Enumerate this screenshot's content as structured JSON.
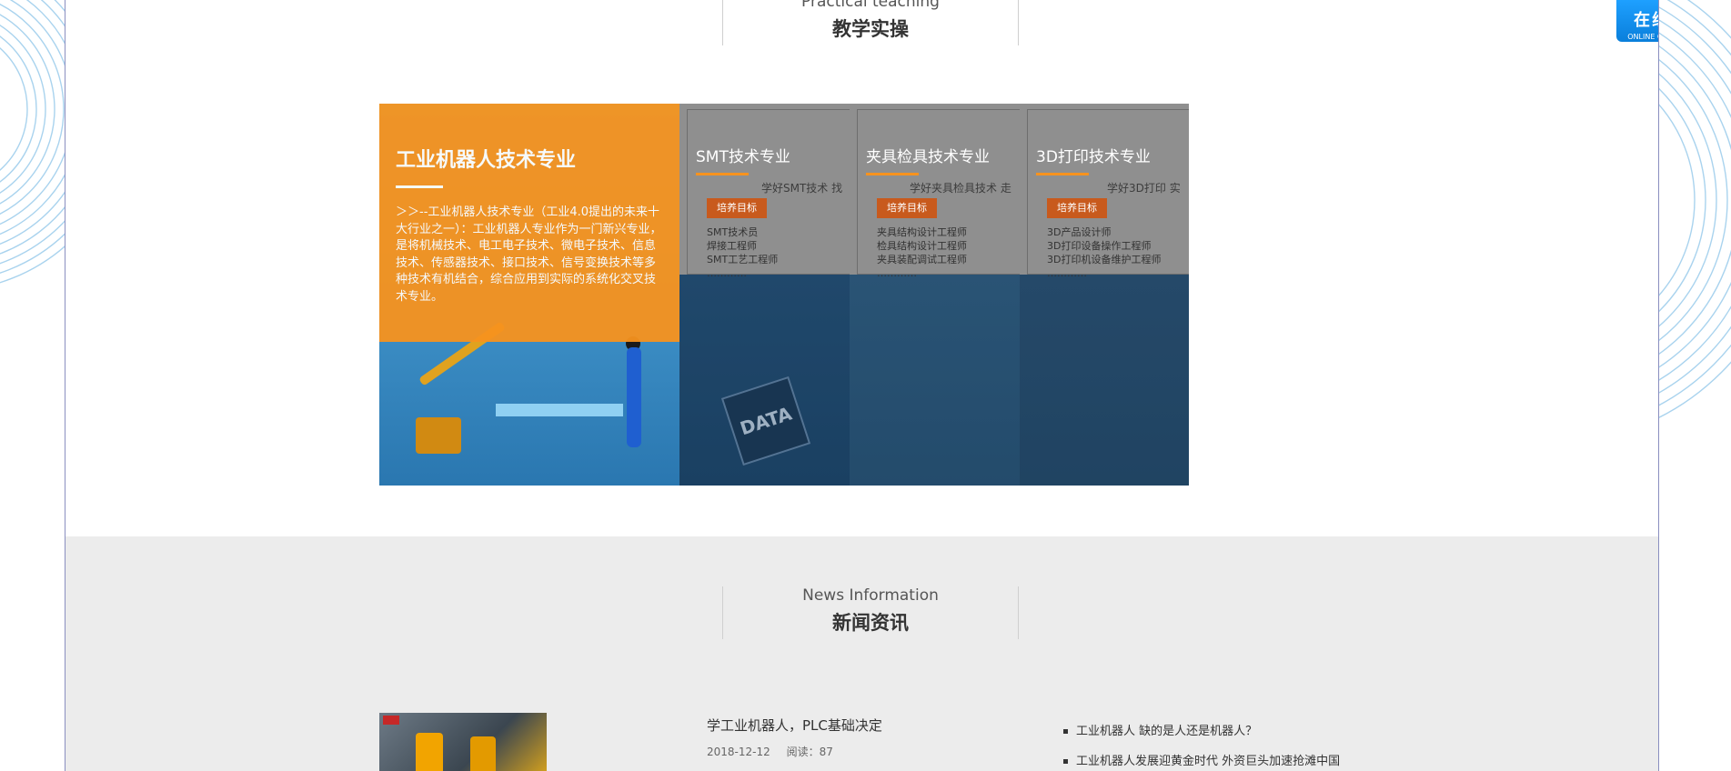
{
  "practical_section": {
    "en_title": "Practical teaching",
    "cn_title": "教学实操"
  },
  "courses": [
    {
      "title": "工业机器人技术专业",
      "description": "＞＞--工业机器人技术专业（工业4.0提出的未来十大行业之一）：工业机器人专业作为一门新兴专业，是将机械技术、电工电子技术、微电子技术、信息技术、传感器技术、接口技术、信号变换技术等多种技术有机结合，综合应用到实际的系统化交叉技术专业。",
      "active": true
    },
    {
      "title": "SMT技术专业",
      "subtitle": "学好SMT技术  找",
      "tag": "培养目标",
      "jobs": [
        "SMT技术员",
        "焊接工程师",
        "SMT工艺工程师",
        "…………"
      ],
      "scene_text": "DATA"
    },
    {
      "title": "夹具检具技术专业",
      "subtitle": "学好夹具检具技术 走",
      "tag": "培养目标",
      "jobs": [
        "夹具结构设计工程师",
        "检具结构设计工程师",
        "夹具装配调试工程师",
        "…………"
      ]
    },
    {
      "title": "3D打印技术专业",
      "subtitle": "学好3D打印  实",
      "tag": "培养目标",
      "jobs": [
        "3D产品设计师",
        "3D打印设备操作工程师",
        "3D打印机设备维护工程师",
        "…………"
      ]
    }
  ],
  "consult": {
    "cn": "在线咨询",
    "en": "ONLINE CONSULTATION"
  },
  "news_section": {
    "en_title": "News Information",
    "cn_title": "新闻资讯",
    "featured": {
      "title": "学工业机器人，PLC基础决定",
      "date": "2018-12-12",
      "reads": "阅读：87"
    },
    "list": [
      "工业机器人 缺的是人还是机器人？",
      "工业机器人发展迎黄金时代 外资巨头加速抢滩中国"
    ]
  },
  "colors": {
    "accent_orange": "#f7931e",
    "consult_blue": "#0a7fdb",
    "frame_line": "#8a8fc0"
  }
}
